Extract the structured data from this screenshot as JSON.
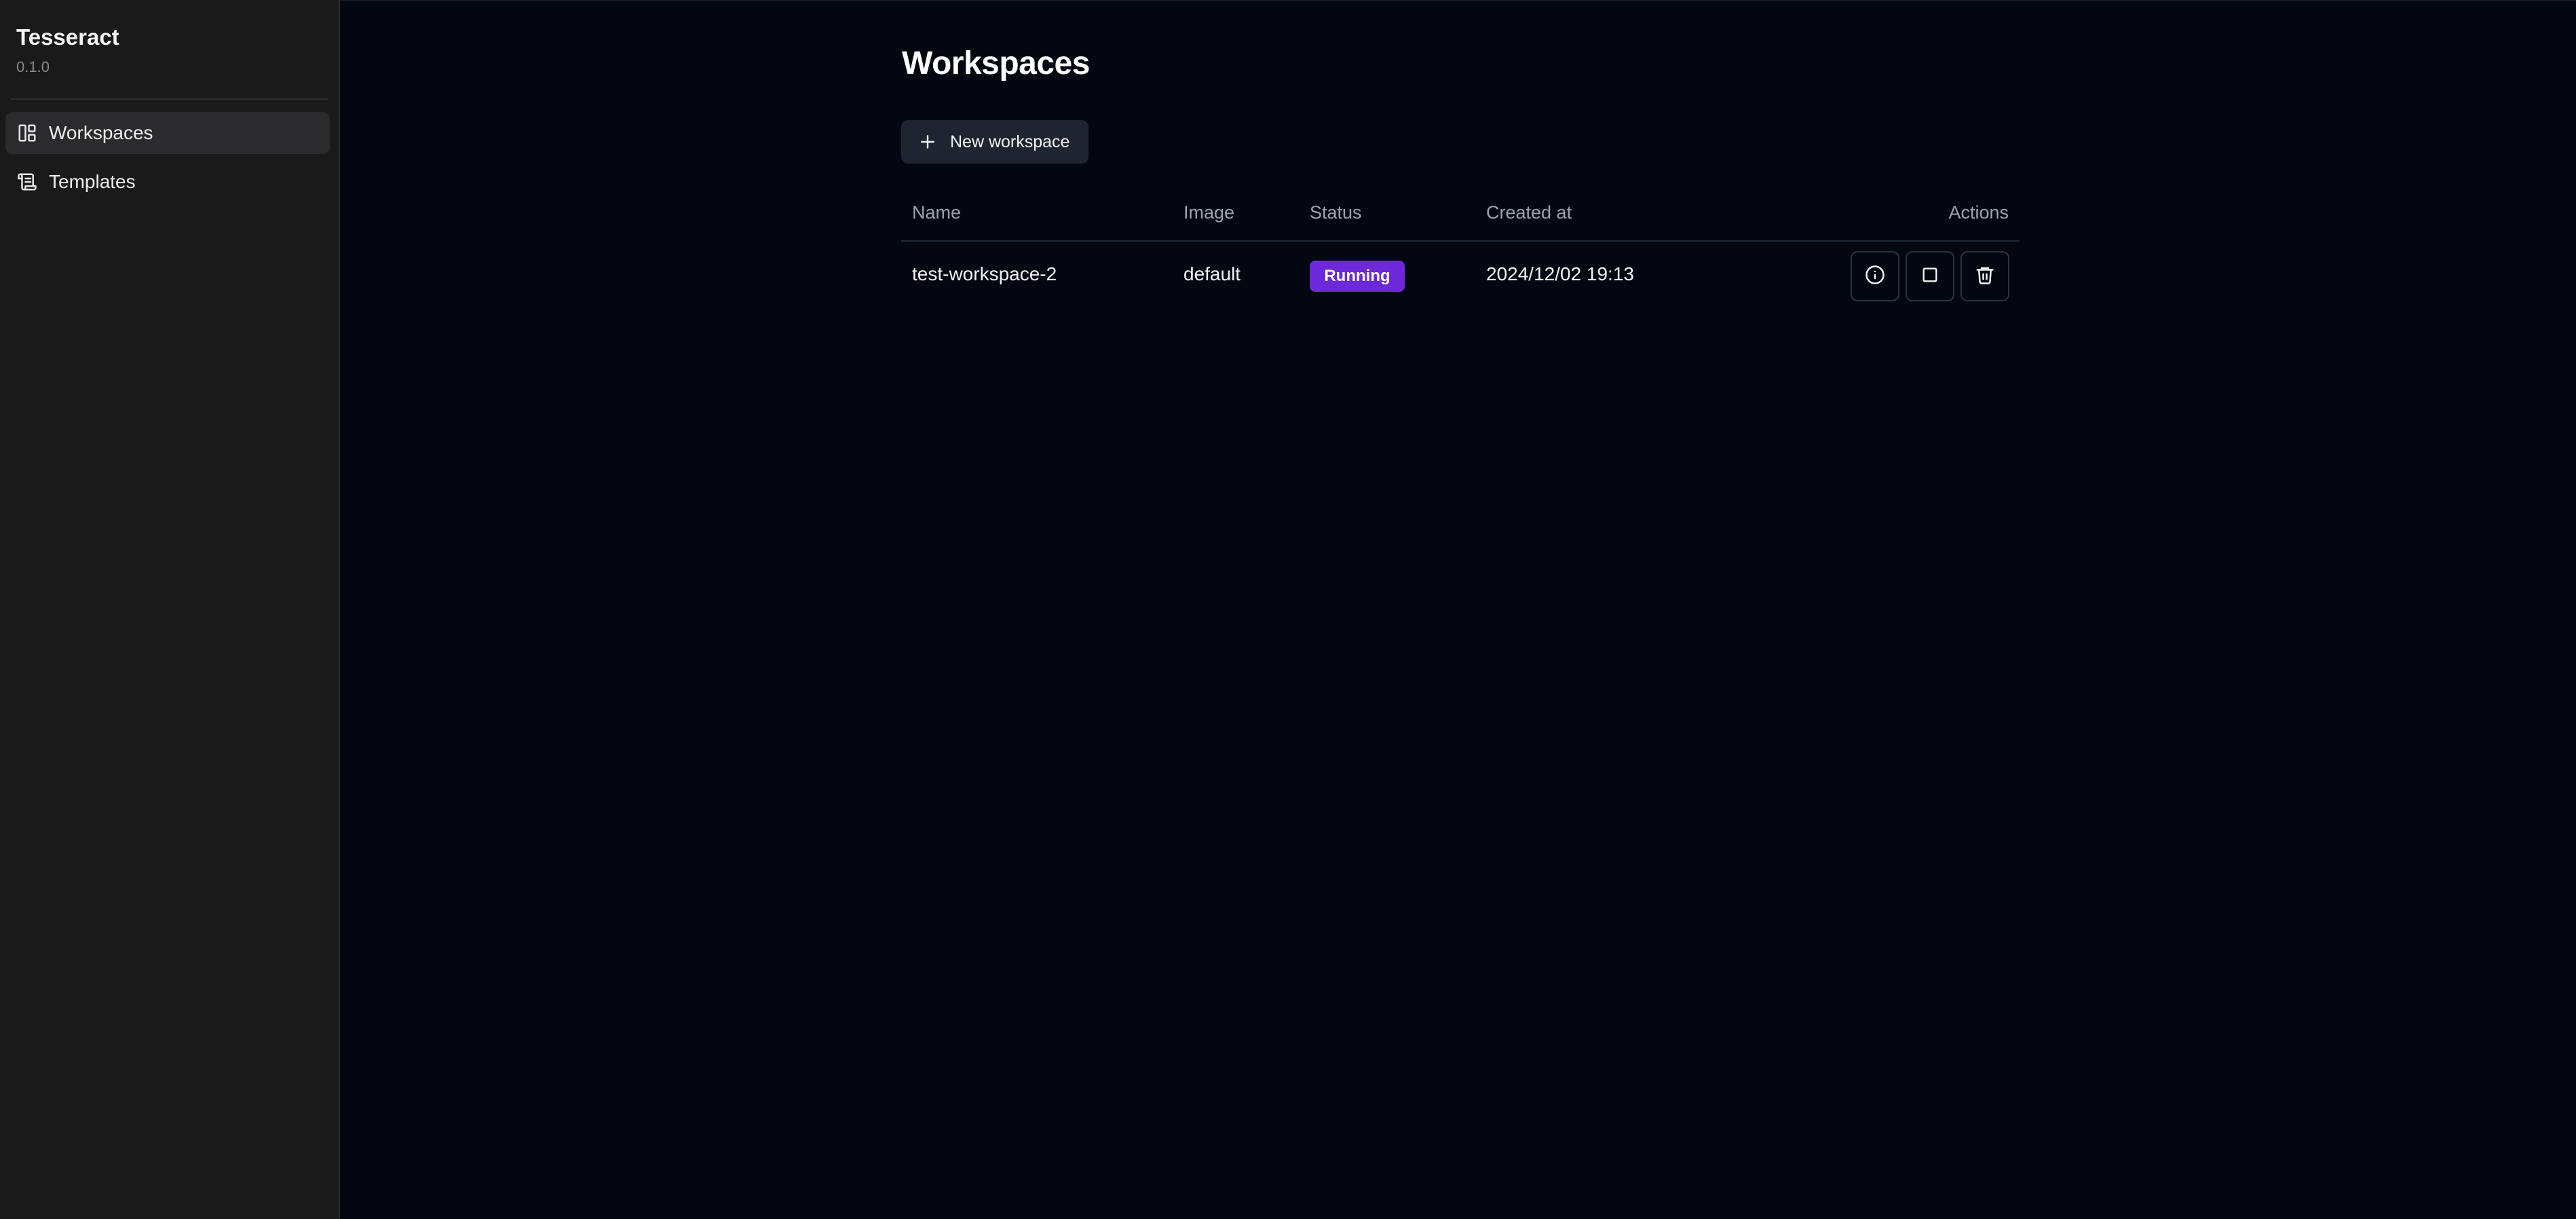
{
  "app": {
    "title": "Tesseract",
    "version": "0.1.0"
  },
  "sidebar": {
    "items": [
      {
        "label": "Workspaces",
        "icon": "dashboard-icon",
        "active": true
      },
      {
        "label": "Templates",
        "icon": "scroll-icon",
        "active": false
      }
    ]
  },
  "main": {
    "title": "Workspaces",
    "new_button_label": "New workspace",
    "table": {
      "columns": [
        "Name",
        "Image",
        "Status",
        "Created at",
        "Actions"
      ],
      "rows": [
        {
          "name": "test-workspace-2",
          "image": "default",
          "status": "Running",
          "created_at": "2024/12/02 19:13"
        }
      ]
    },
    "row_actions": [
      "info-icon",
      "stop-icon",
      "trash-icon"
    ]
  },
  "colors": {
    "background": "#030712",
    "sidebar": "#1a1a1b",
    "badge_running": "#6d28d9",
    "button_bg": "#1f2530"
  }
}
